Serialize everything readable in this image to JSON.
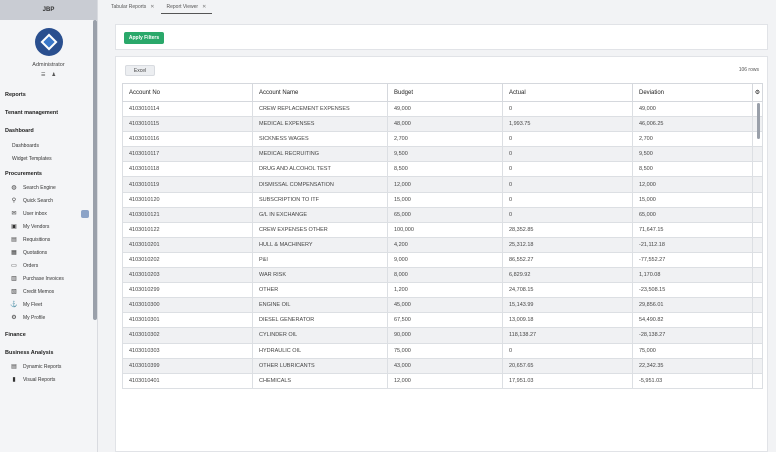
{
  "sidebar": {
    "title": "JBP",
    "user": "Administrator",
    "sections": {
      "reports": "Reports",
      "tenant": "Tenant management",
      "dashboard": "Dashboard",
      "procurements": "Procurements",
      "finance": "Finance",
      "business_analysis": "Business Analysis"
    },
    "dashboard_items": [
      "Dashboards",
      "Widget Templates"
    ],
    "procurement_items": [
      {
        "label": "Search Engine",
        "icon": "globe-icon"
      },
      {
        "label": "Quick Search",
        "icon": "search-icon"
      },
      {
        "label": "User inbox",
        "icon": "inbox-icon"
      },
      {
        "label": "My Vendors",
        "icon": "vendors-icon"
      },
      {
        "label": "Requisitions",
        "icon": "requisitions-icon"
      },
      {
        "label": "Quotations",
        "icon": "quotations-icon"
      },
      {
        "label": "Orders",
        "icon": "orders-icon"
      },
      {
        "label": "Purchase Invoices",
        "icon": "invoice-icon"
      },
      {
        "label": "Credit Memos",
        "icon": "credit-memo-icon"
      },
      {
        "label": "My Fleet",
        "icon": "fleet-icon"
      },
      {
        "label": "My Profile",
        "icon": "profile-icon"
      }
    ],
    "business_items": [
      {
        "label": "Dynamic Reports",
        "icon": "dynamic-reports-icon"
      },
      {
        "label": "Visual Reports",
        "icon": "visual-reports-icon"
      }
    ]
  },
  "tabs": [
    {
      "label": "Tabular Reports"
    },
    {
      "label": "Report Viewer"
    }
  ],
  "filters": {
    "apply_label": "Apply Filters"
  },
  "report": {
    "excel_label": "Excel",
    "rows_count": "106 rows",
    "columns": [
      "Account No",
      "Account Name",
      "Budget",
      "Actual",
      "Deviation"
    ],
    "rows": [
      [
        "4103010114",
        "CREW REPLACEMENT EXPENSES",
        "49,000",
        "0",
        "49,000"
      ],
      [
        "4103010115",
        "MEDICAL EXPENSES",
        "48,000",
        "1,993.75",
        "46,006.25"
      ],
      [
        "4103010116",
        "SICKNESS WAGES",
        "2,700",
        "0",
        "2,700"
      ],
      [
        "4103010117",
        "MEDICAL RECRUITING",
        "9,500",
        "0",
        "9,500"
      ],
      [
        "4103010118",
        "DRUG AND ALCOHOL TEST",
        "8,500",
        "0",
        "8,500"
      ],
      [
        "4103010119",
        "DISMISSAL COMPENSATION",
        "12,000",
        "0",
        "12,000"
      ],
      [
        "4103010120",
        "SUBSCRIPTION TO ITF",
        "15,000",
        "0",
        "15,000"
      ],
      [
        "4103010121",
        "G/L IN EXCHANGE",
        "65,000",
        "0",
        "65,000"
      ],
      [
        "4103010122",
        "CREW EXPENSES OTHER",
        "100,000",
        "28,352.85",
        "71,647.15"
      ],
      [
        "4103010201",
        "HULL & MACHINERY",
        "4,200",
        "25,312.18",
        "-21,112.18"
      ],
      [
        "4103010202",
        "P&I",
        "9,000",
        "86,552.27",
        "-77,552.27"
      ],
      [
        "4103010203",
        "WAR RISK",
        "8,000",
        "6,829.92",
        "1,170.08"
      ],
      [
        "4103010299",
        "OTHER",
        "1,200",
        "24,708.15",
        "-23,508.15"
      ],
      [
        "4103010300",
        "ENGINE OIL",
        "45,000",
        "15,143.99",
        "29,856.01"
      ],
      [
        "4103010301",
        "DIESEL GENERATOR",
        "67,500",
        "13,009.18",
        "54,490.82"
      ],
      [
        "4103010302",
        "CYLINDER OIL",
        "90,000",
        "118,138.27",
        "-28,138.27"
      ],
      [
        "4103010303",
        "HYDRAULIC OIL",
        "75,000",
        "0",
        "75,000"
      ],
      [
        "4103010399",
        "OTHER LUBRICANTS",
        "43,000",
        "20,657.65",
        "22,342.35"
      ],
      [
        "4103010401",
        "CHEMICALS",
        "12,000",
        "17,951.03",
        "-5,951.03"
      ]
    ]
  }
}
